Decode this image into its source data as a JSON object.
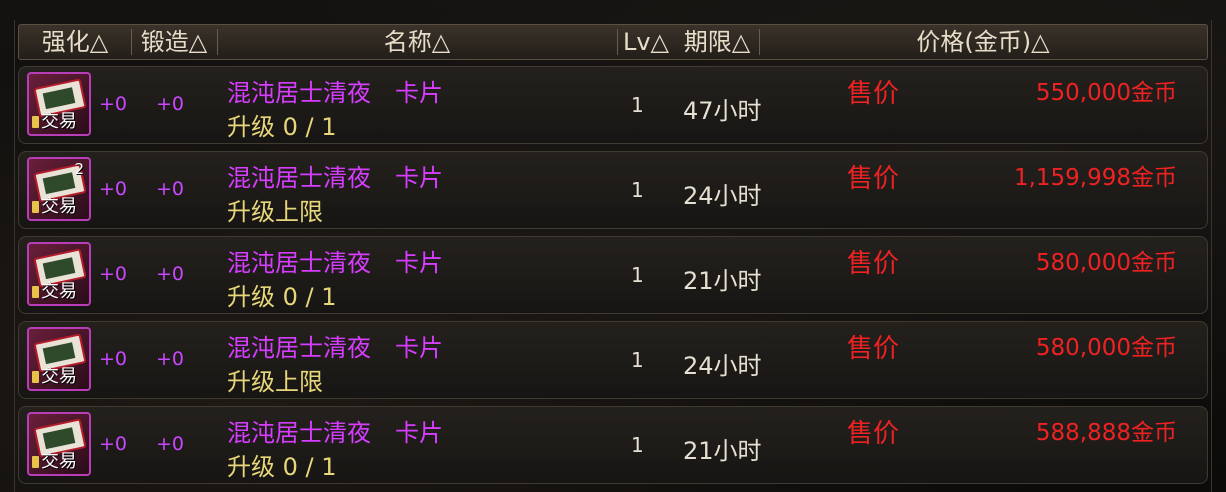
{
  "header": {
    "enhance": "强化△",
    "forge": "锻造△",
    "name": "名称△",
    "lv": "Lv△",
    "period": "期限△",
    "price": "价格(金币)△"
  },
  "colors": {
    "item_name": "#d63dff",
    "upgrade_text": "#e8d77a",
    "price": "#ee2222",
    "plus": "#c847ff"
  },
  "icon_name": "card-item-icon",
  "rows": [
    {
      "stack": "",
      "trade": "交易",
      "enhance": "+0",
      "forge": "+0",
      "name": "混沌居士清夜　卡片",
      "upgrade": "升级 0 / 1",
      "lv": "1",
      "period": "47小时",
      "sell_label": "售价",
      "price": "550,000金币"
    },
    {
      "stack": "2",
      "trade": "交易",
      "enhance": "+0",
      "forge": "+0",
      "name": "混沌居士清夜　卡片",
      "upgrade": "升级上限",
      "lv": "1",
      "period": "24小时",
      "sell_label": "售价",
      "price": "1,159,998金币"
    },
    {
      "stack": "",
      "trade": "交易",
      "enhance": "+0",
      "forge": "+0",
      "name": "混沌居士清夜　卡片",
      "upgrade": "升级 0 / 1",
      "lv": "1",
      "period": "21小时",
      "sell_label": "售价",
      "price": "580,000金币"
    },
    {
      "stack": "",
      "trade": "交易",
      "enhance": "+0",
      "forge": "+0",
      "name": "混沌居士清夜　卡片",
      "upgrade": "升级上限",
      "lv": "1",
      "period": "24小时",
      "sell_label": "售价",
      "price": "580,000金币"
    },
    {
      "stack": "",
      "trade": "交易",
      "enhance": "+0",
      "forge": "+0",
      "name": "混沌居士清夜　卡片",
      "upgrade": "升级 0 / 1",
      "lv": "1",
      "period": "21小时",
      "sell_label": "售价",
      "price": "588,888金币"
    }
  ]
}
